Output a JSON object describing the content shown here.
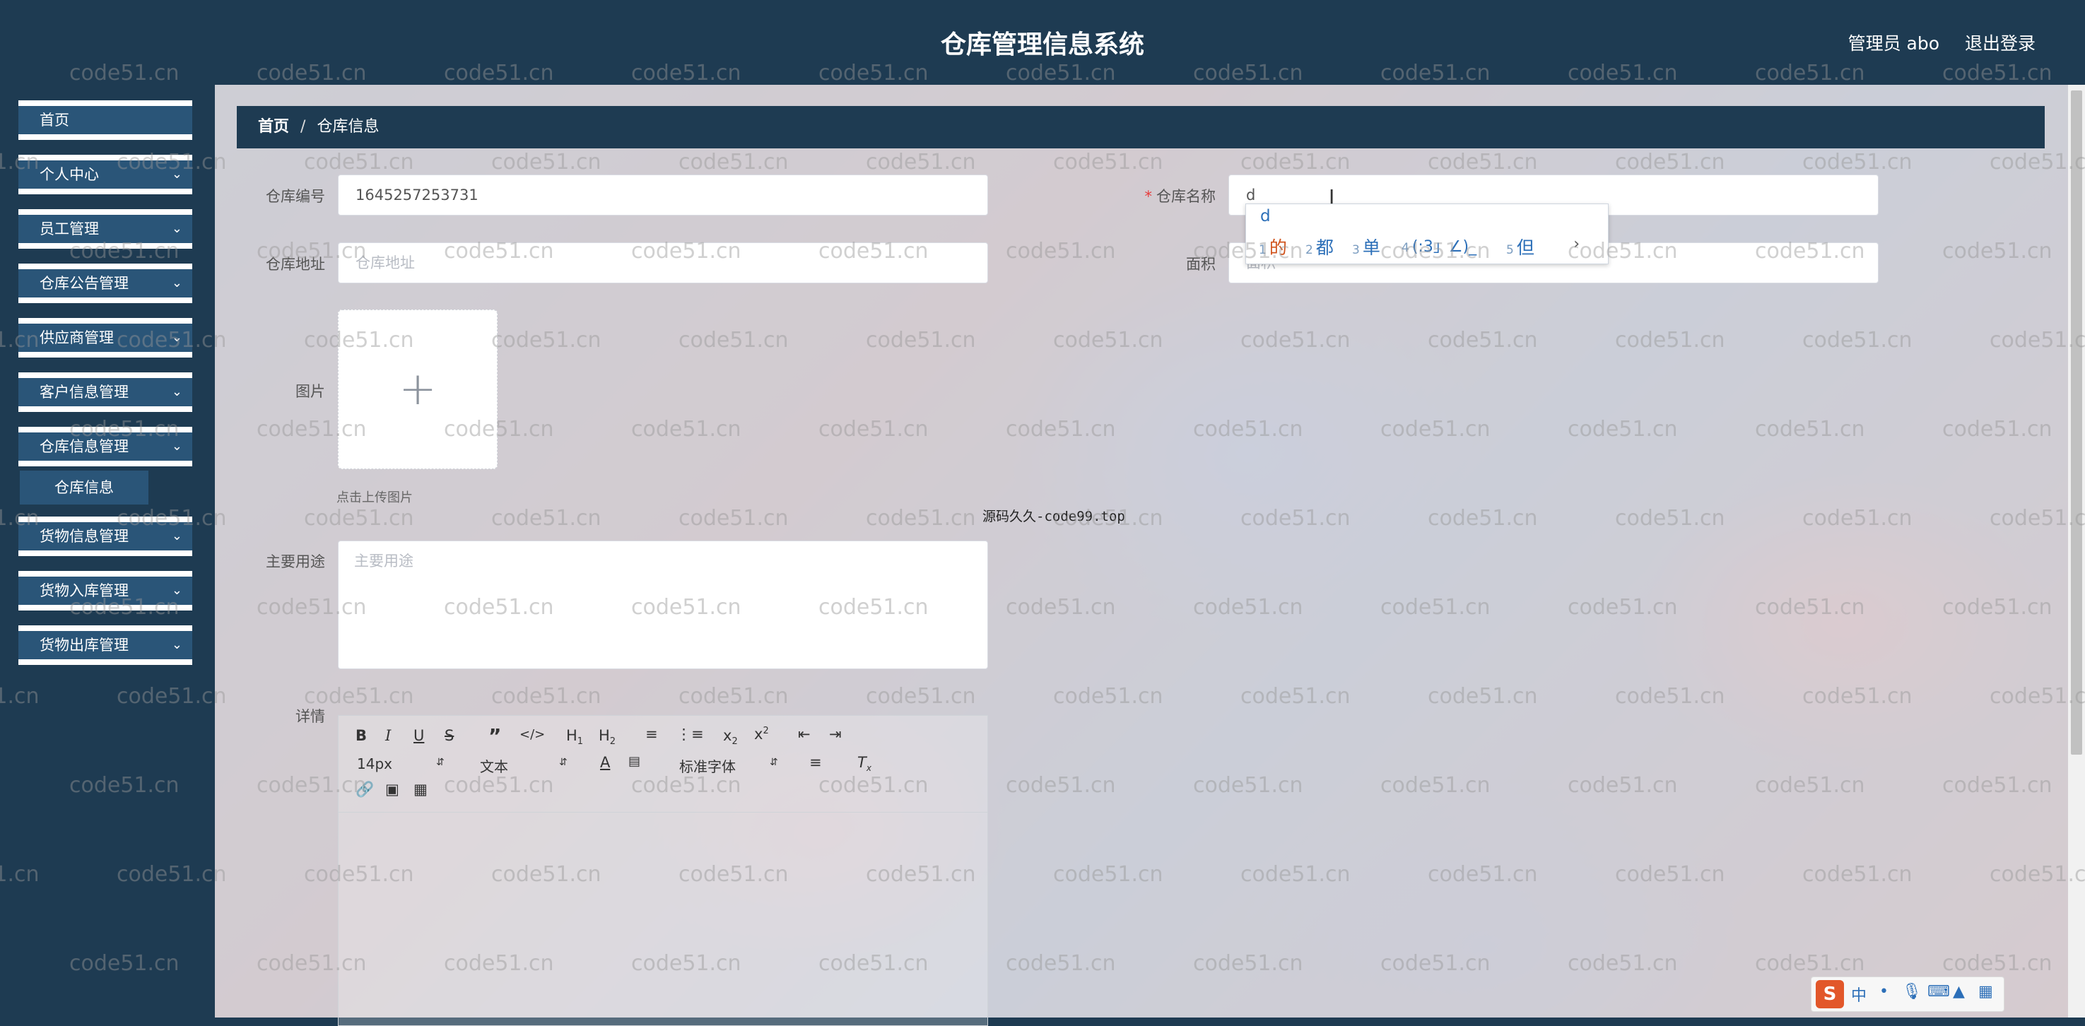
{
  "header": {
    "title": "仓库管理信息系统",
    "user": "管理员 abo",
    "logout": "退出登录"
  },
  "sidebar": {
    "items": [
      {
        "label": "首页"
      },
      {
        "label": "个人中心"
      },
      {
        "label": "员工管理"
      },
      {
        "label": "仓库公告管理"
      },
      {
        "label": "供应商管理"
      },
      {
        "label": "客户信息管理"
      },
      {
        "label": "仓库信息管理"
      },
      {
        "label": "货物信息管理"
      },
      {
        "label": "货物入库管理"
      },
      {
        "label": "货物出库管理"
      }
    ],
    "submenu": {
      "label": "仓库信息"
    },
    "chevron": "chevron-down-icon"
  },
  "breadcrumb": {
    "home": "首页",
    "separator": "/",
    "current": "仓库信息"
  },
  "form": {
    "warehouse_no": {
      "label": "仓库编号",
      "value": "1645257253731"
    },
    "warehouse_name": {
      "label": "仓库名称",
      "value": "d",
      "required_mark": "*"
    },
    "address": {
      "label": "仓库地址",
      "placeholder": "仓库地址"
    },
    "area": {
      "label": "面积",
      "placeholder": "面积"
    },
    "image": {
      "label": "图片",
      "upload_tip": "点击上传图片",
      "icon": "plus-icon"
    },
    "usage": {
      "label": "主要用途",
      "placeholder": "主要用途"
    },
    "detail": {
      "label": "详情"
    }
  },
  "editor": {
    "font_size": "14px",
    "block_format": "文本",
    "font_family": "标准字体",
    "buttons": [
      "bold",
      "italic",
      "underline",
      "strike",
      "blockquote",
      "code-block",
      "header-1",
      "header-2",
      "ordered-list",
      "bullet-list",
      "subscript",
      "superscript",
      "indent-left",
      "indent-right",
      "text-color",
      "background-color",
      "align",
      "clean",
      "link",
      "image",
      "video"
    ]
  },
  "overlay_text": "源码久久-code99.top",
  "watermark": "code51.cn",
  "ime": {
    "input": "d",
    "candidates": [
      {
        "num": "1",
        "text": "的"
      },
      {
        "num": "2",
        "text": "都"
      },
      {
        "num": "3",
        "text": "单"
      },
      {
        "num": "4",
        "text": "(:3」∠)_"
      },
      {
        "num": "5",
        "text": "但"
      }
    ],
    "next": "›"
  },
  "tray": {
    "logo": "S",
    "lang": "中"
  },
  "colors": {
    "nav_bg": "#1e3b52",
    "menu_item_bg": "#2a5578",
    "required": "#e63c3c"
  }
}
